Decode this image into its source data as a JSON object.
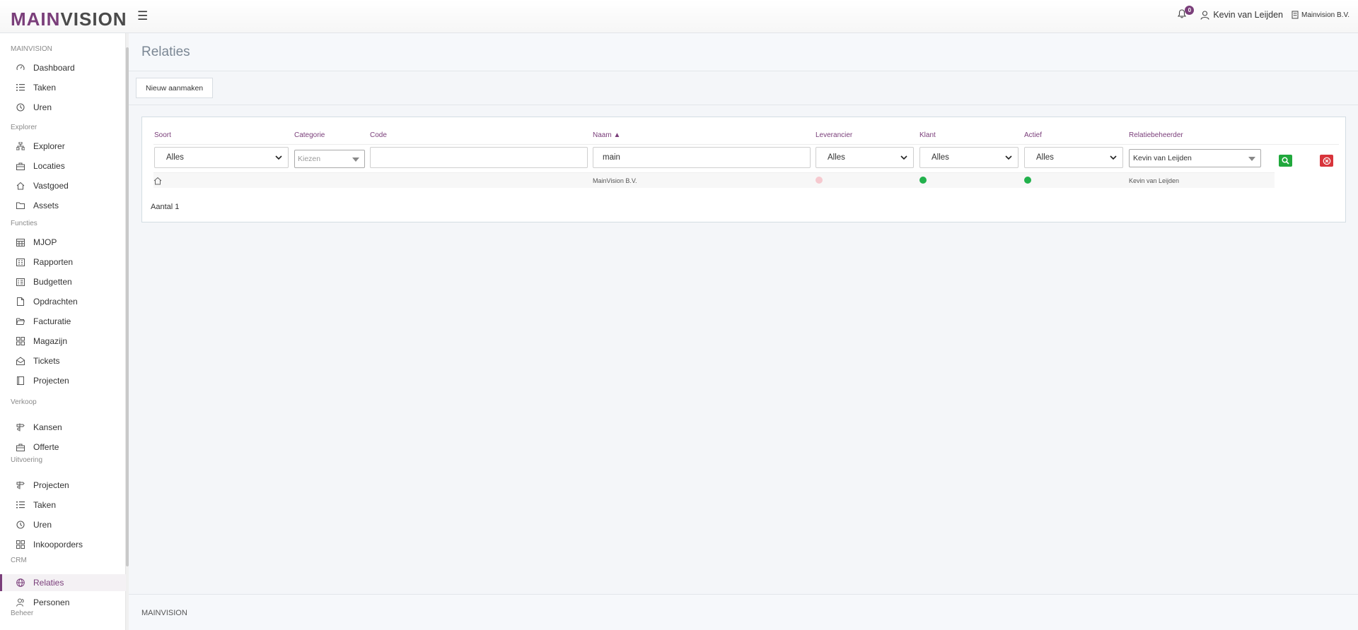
{
  "header": {
    "logo_main": "MAIN",
    "logo_vision": "VISION",
    "notifications": "0",
    "user_name": "Kevin van Leijden",
    "company": "Mainvision B.V."
  },
  "sidebar": {
    "sections": [
      {
        "title": "MAINVISION",
        "items": [
          {
            "label": "Dashboard",
            "icon": "gauge-icon"
          },
          {
            "label": "Taken",
            "icon": "list-icon"
          },
          {
            "label": "Uren",
            "icon": "clock-icon"
          }
        ]
      },
      {
        "title": "Explorer",
        "items": [
          {
            "label": "Explorer",
            "icon": "sitemap-icon"
          },
          {
            "label": "Locaties",
            "icon": "briefcase-icon"
          },
          {
            "label": "Vastgoed",
            "icon": "home-icon"
          },
          {
            "label": "Assets",
            "icon": "folder-icon"
          }
        ]
      },
      {
        "title": "Functies",
        "items": [
          {
            "label": "MJOP",
            "icon": "calendar-icon"
          },
          {
            "label": "Rapporten",
            "icon": "report-icon"
          },
          {
            "label": "Budgetten",
            "icon": "budget-icon"
          },
          {
            "label": "Opdrachten",
            "icon": "file-icon"
          },
          {
            "label": "Facturatie",
            "icon": "folder-open-icon"
          },
          {
            "label": "Magazijn",
            "icon": "grid-icon"
          },
          {
            "label": "Tickets",
            "icon": "envelope-open-icon"
          },
          {
            "label": "Projecten",
            "icon": "book-icon"
          }
        ]
      },
      {
        "title": "Verkoop",
        "items": [
          {
            "label": "Kansen",
            "icon": "signpost-icon"
          },
          {
            "label": "Offerte",
            "icon": "briefcase-icon"
          }
        ]
      },
      {
        "title": "Uitvoering",
        "items": [
          {
            "label": "Projecten",
            "icon": "signpost-icon"
          },
          {
            "label": "Taken",
            "icon": "list-icon"
          },
          {
            "label": "Uren",
            "icon": "clock-icon"
          },
          {
            "label": "Inkooporders",
            "icon": "grid-icon"
          }
        ]
      },
      {
        "title": "CRM",
        "items": [
          {
            "label": "Relaties",
            "icon": "globe-icon",
            "active": true
          },
          {
            "label": "Personen",
            "icon": "users-icon"
          }
        ]
      },
      {
        "title": "Beheer",
        "items": []
      }
    ]
  },
  "page": {
    "title": "Relaties",
    "new_button": "Nieuw aanmaken"
  },
  "filters": {
    "soort_label": "Soort",
    "soort_value": "Alles",
    "categorie_label": "Categorie",
    "categorie_placeholder": "Kiezen",
    "code_label": "Code",
    "code_value": "",
    "naam_label": "Naam ▲",
    "naam_value": "main",
    "leverancier_label": "Leverancier",
    "leverancier_value": "Alles",
    "klant_label": "Klant",
    "klant_value": "Alles",
    "actief_label": "Actief",
    "actief_value": "Alles",
    "relatiebeheerder_label": "Relatiebeheerder",
    "relatiebeheerder_value": "Kevin van Leijden"
  },
  "results": {
    "rows": [
      {
        "naam": "MainVision B.V.",
        "leverancier": false,
        "klant": true,
        "actief": true,
        "relatiebeheerder": "Kevin van Leijden"
      }
    ],
    "count_text": "Aantal 1"
  },
  "colors": {
    "brand": "#7a3e7a",
    "active_dot": "#22b14c",
    "inactive_dot": "#f6c9cf"
  },
  "footer": {
    "text": "MAINVISION"
  }
}
